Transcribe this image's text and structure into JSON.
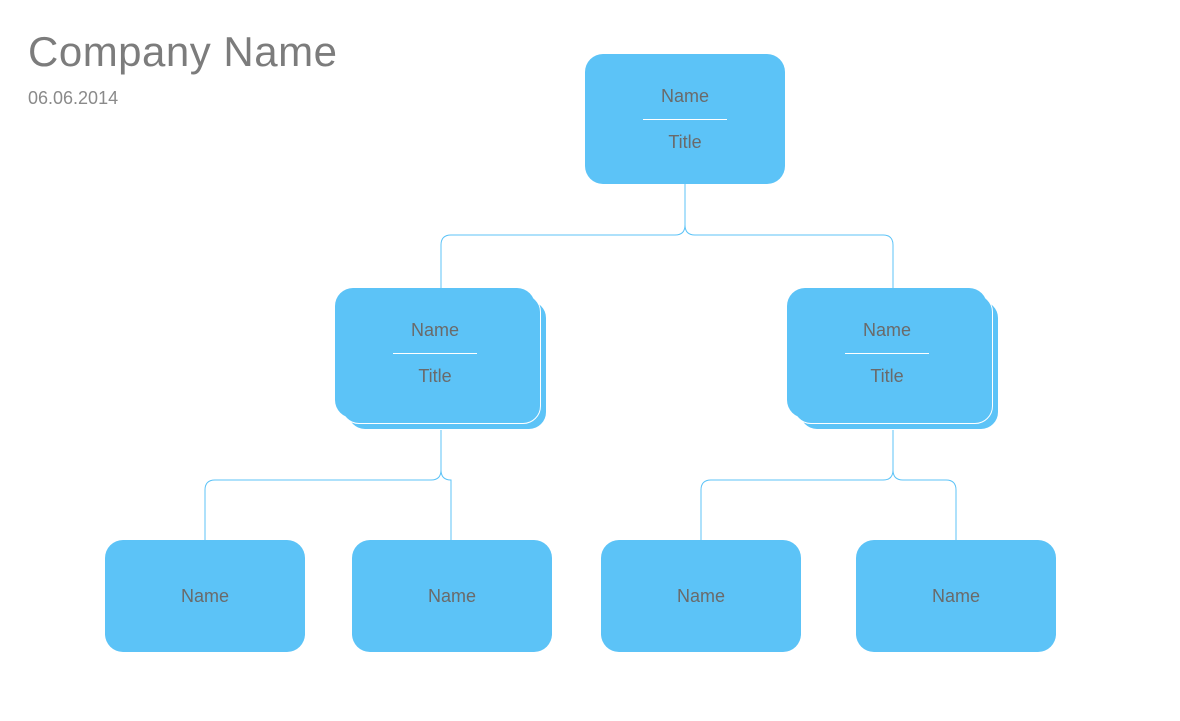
{
  "header": {
    "company_name": "Company Name",
    "date": "06.06.2014"
  },
  "org": {
    "root": {
      "name": "Name",
      "title": "Title"
    },
    "level2": [
      {
        "name": "Name",
        "title": "Title"
      },
      {
        "name": "Name",
        "title": "Title"
      }
    ],
    "level3": [
      {
        "name": "Name"
      },
      {
        "name": "Name"
      },
      {
        "name": "Name"
      },
      {
        "name": "Name"
      }
    ]
  },
  "colors": {
    "node_fill": "#5cc3f7",
    "text": "#6a6a6a",
    "heading": "#7c7c7c"
  }
}
